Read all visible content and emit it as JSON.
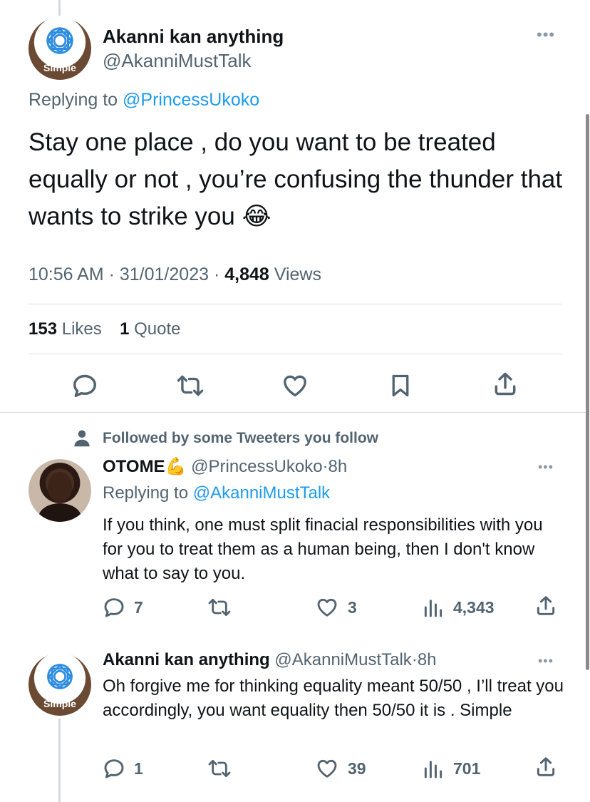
{
  "main_tweet": {
    "author_name": "Akanni kan anything",
    "author_handle": "@AkanniMustTalk",
    "avatar_text": "Simple",
    "replying_prefix": "Replying to",
    "replying_to": "@PrincessUkoko",
    "text": "Stay one place , do you want to be treated equally or not , you’re confusing the thunder that wants to strike you 😂",
    "time": "10:56 AM",
    "date": "31/01/2023",
    "views_count": "4,848",
    "views_label": "Views",
    "likes_count": "153",
    "likes_label": "Likes",
    "quotes_count": "1",
    "quotes_label": "Quote",
    "separator": "·"
  },
  "reply1": {
    "social_context": "Followed by some Tweeters you follow",
    "author_name": "OTOME💪",
    "author_handle": "@PrincessUkoko",
    "time": "8h",
    "separator": "·",
    "replying_prefix": "Replying to",
    "replying_to": "@AkanniMustTalk",
    "text": "If you think, one must split finacial responsibilities with you for you to treat them as a human being, then I don't know what to say to you.",
    "replies": "7",
    "retweets": "",
    "likes": "3",
    "views": "4,343"
  },
  "reply2": {
    "author_name": "Akanni kan anything",
    "author_handle": "@AkanniMustTalk",
    "time": "8h",
    "separator": "·",
    "avatar_text": "Simple",
    "text": "Oh forgive me for thinking equality meant 50/50 , I’ll treat you accordingly, you want equality then 50/50 it is . Simple",
    "replies": "1",
    "retweets": "",
    "likes": "39",
    "views": "701"
  },
  "icons": {
    "reply": "reply-icon",
    "retweet": "retweet-icon",
    "like": "heart-icon",
    "bookmark": "bookmark-icon",
    "share": "share-icon",
    "views": "views-chart-icon",
    "person": "person-icon",
    "more": "more-options-icon"
  },
  "colors": {
    "link_blue": "#1d9bf0",
    "secondary_text": "#536471",
    "text": "#0f1419"
  }
}
